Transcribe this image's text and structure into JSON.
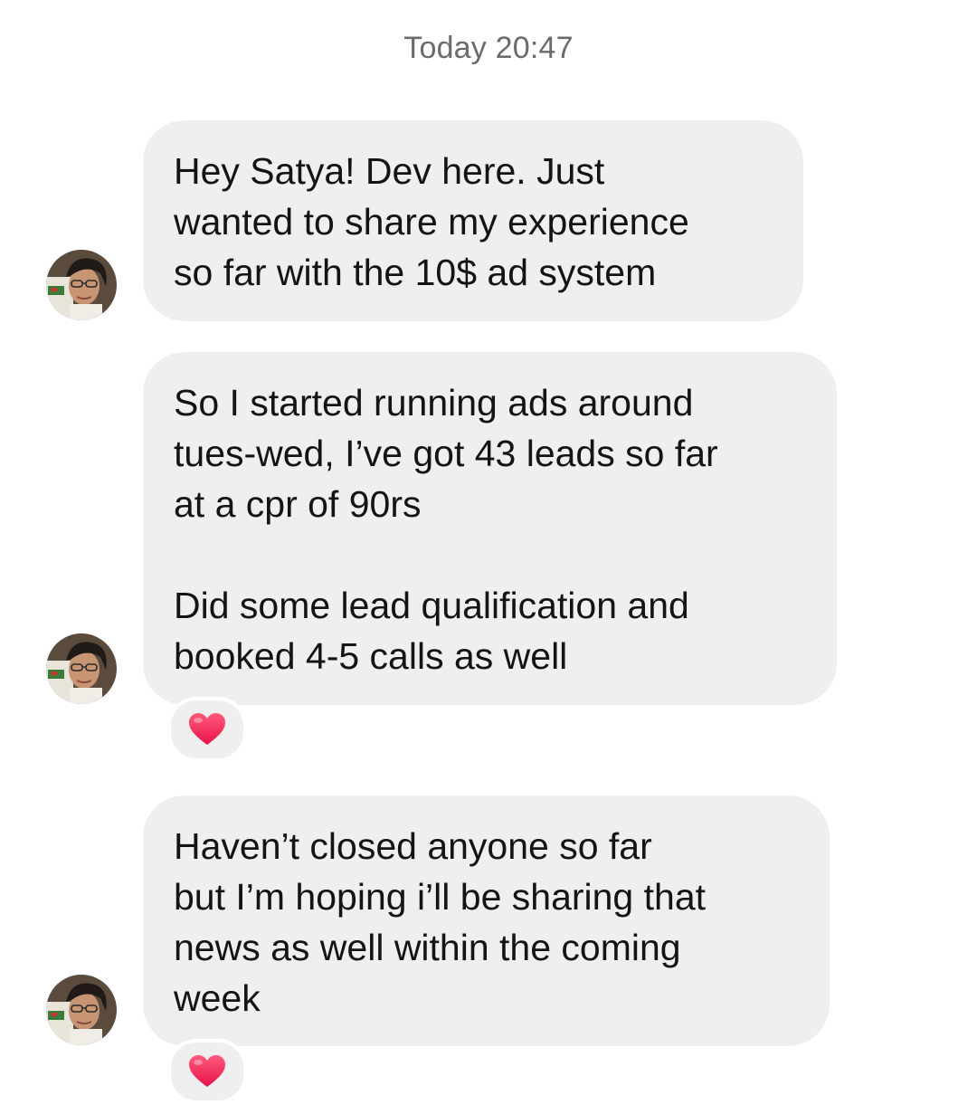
{
  "thread": {
    "timestamp": "Today 20:47"
  },
  "messages": [
    {
      "text": "Hey Satya! Dev here. Just\nwanted to share my experience\nso far with the 10$ ad system",
      "avatar_icon": "user-avatar-photo",
      "reaction": null
    },
    {
      "text": "So I started running ads around\ntues-wed, I’ve got 43 leads so far\nat a cpr of 90rs\n\nDid some lead qualification and\nbooked 4-5 calls as well",
      "avatar_icon": "user-avatar-photo",
      "reaction": "heart-icon"
    },
    {
      "text": "Haven’t closed anyone so far\nbut I’m hoping i’ll be sharing that\nnews as well within the coming\nweek",
      "avatar_icon": "user-avatar-photo",
      "reaction": "heart-icon"
    }
  ],
  "colors": {
    "bubble": "#efefef",
    "heart": "#f0325a",
    "timestamp": "#6b6b6b"
  }
}
